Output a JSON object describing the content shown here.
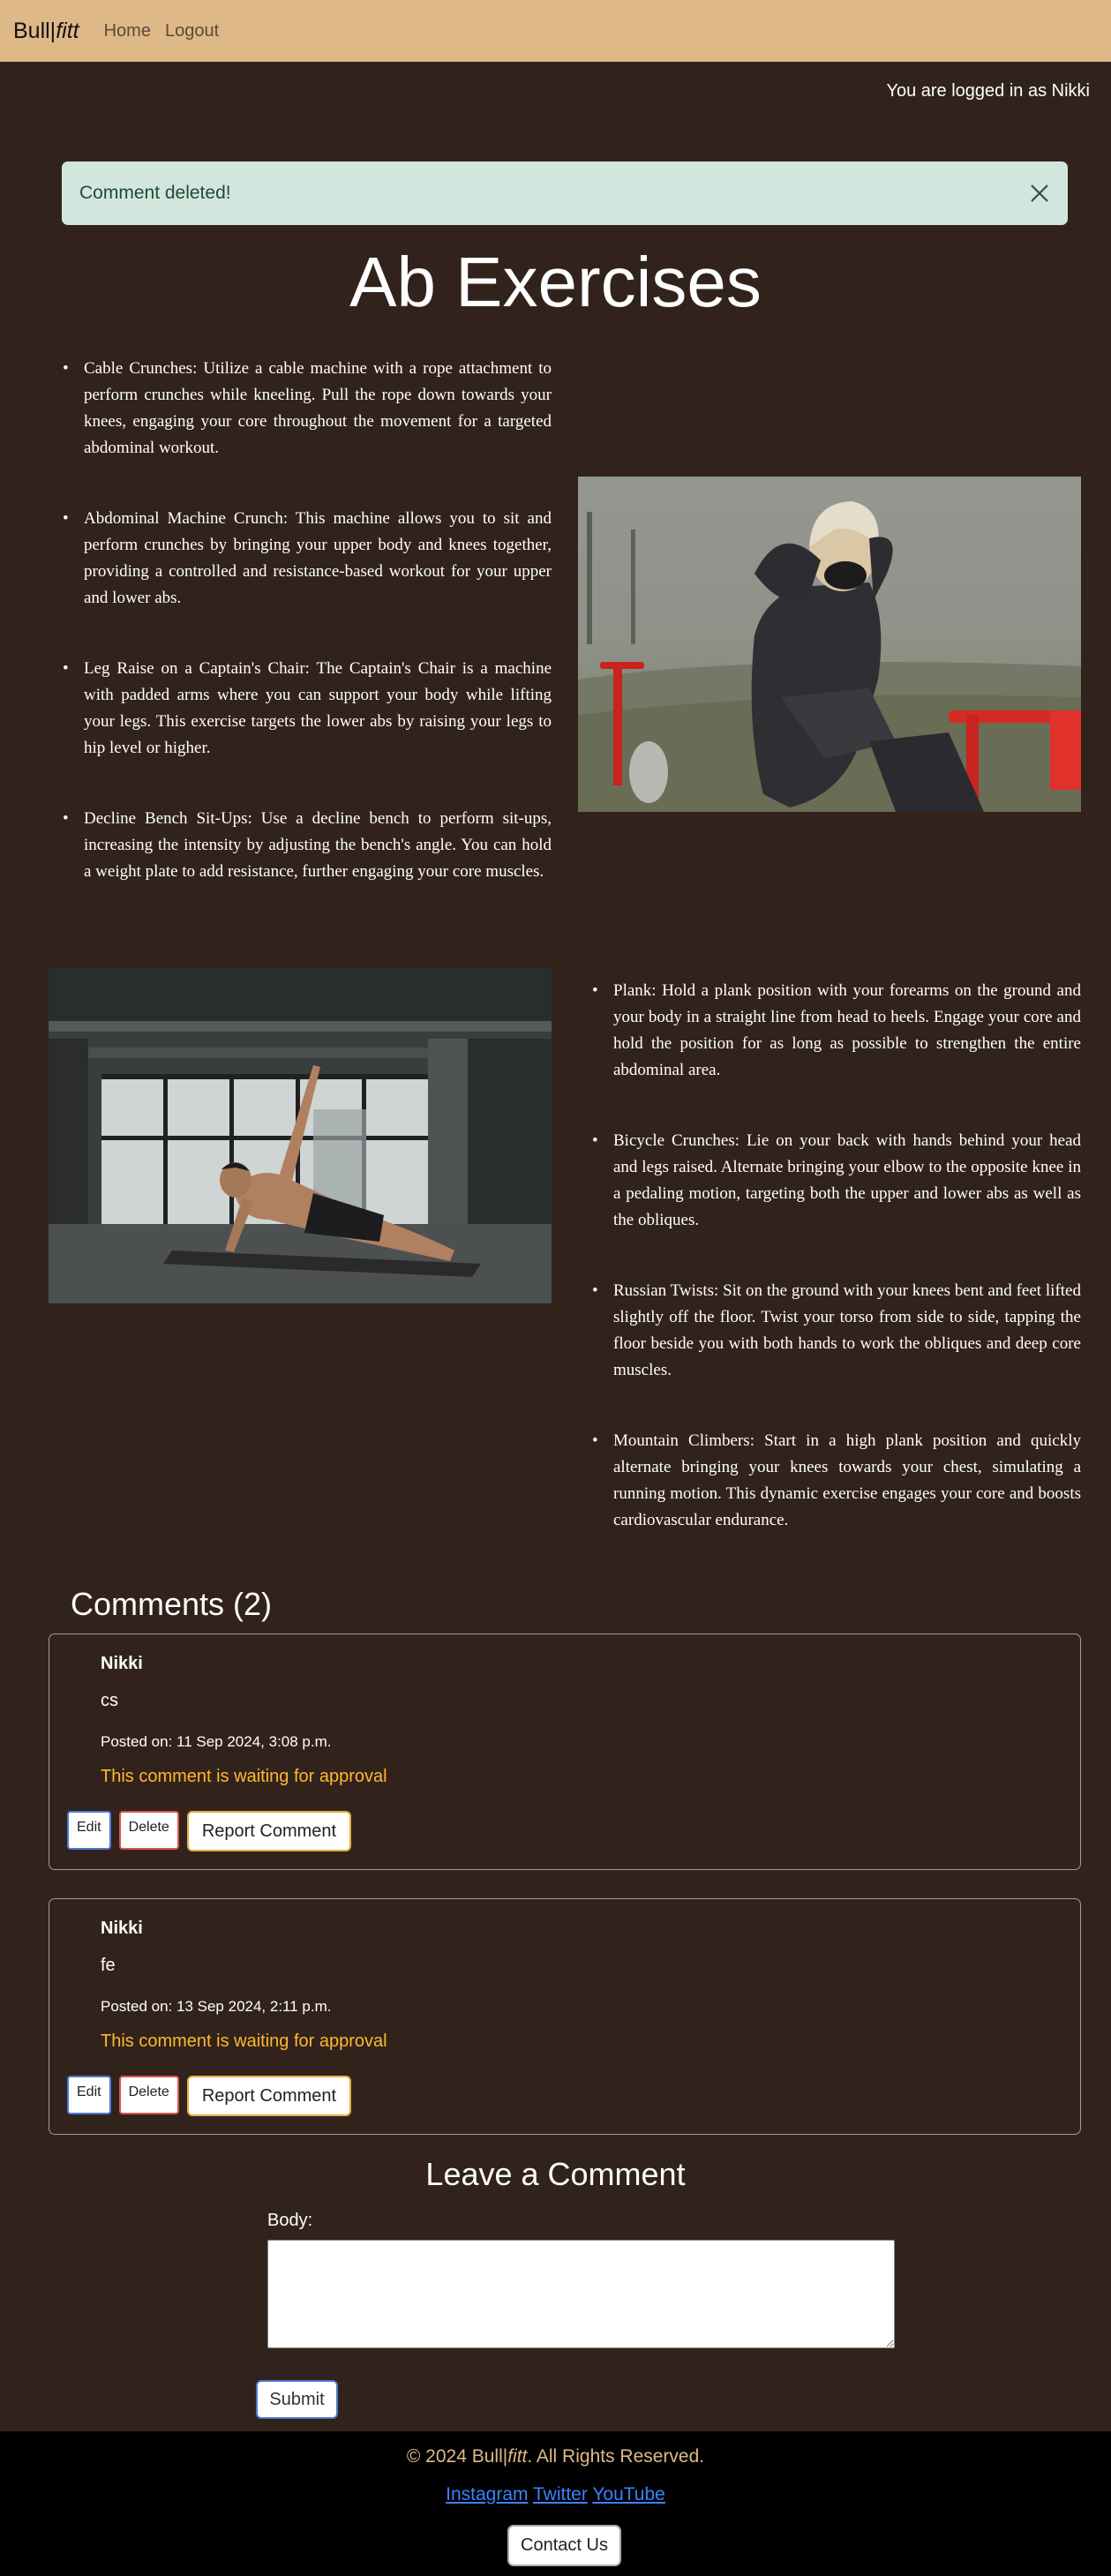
{
  "nav": {
    "brand_part1": "Bull|",
    "brand_part2": "fitt",
    "links": [
      "Home",
      "Logout"
    ]
  },
  "user": {
    "logged_in_text": "You are logged in as Nikki"
  },
  "alert": {
    "message": "Comment deleted!",
    "close_icon": "close-icon"
  },
  "page": {
    "title": "Ab Exercises"
  },
  "exercises_left": [
    "Cable Crunches: Utilize a cable machine with a rope attachment to perform crunches while kneeling. Pull the rope down towards your knees, engaging your core throughout the movement for a targeted abdominal workout.",
    "Abdominal Machine Crunch: This machine allows you to sit and perform crunches by bringing your upper body and knees together, providing a controlled and resistance-based workout for your upper and lower abs.",
    "Leg Raise on a Captain's Chair: The Captain's Chair is a machine with padded arms where you can support your body while lifting your legs. This exercise targets the lower abs by raising your legs to hip level or higher.",
    "Decline Bench Sit-Ups: Use a decline bench to perform sit-ups, increasing the intensity by adjusting the bench's angle. You can hold a weight plate to add resistance, further engaging your core muscles."
  ],
  "exercises_right": [
    "Plank: Hold a plank position with your forearms on the ground and your body in a straight line from head to heels. Engage your core and hold the position for as long as possible to strengthen the entire abdominal area.",
    "Bicycle Crunches: Lie on your back with hands behind your head and legs raised. Alternate bringing your elbow to the opposite knee in a pedaling motion, targeting both the upper and lower abs as well as the obliques.",
    "Russian Twists: Sit on the ground with your knees bent and feet lifted slightly off the floor. Twist your torso from side to side, tapping the floor beside you with both hands to work the obliques and deep core muscles.",
    "Mountain Climbers: Start in a high plank position and quickly alternate bringing your knees towards your chest, simulating a running motion. This dynamic exercise engages your core and boosts cardiovascular endurance."
  ],
  "comments": {
    "heading": "Comments (2)",
    "items": [
      {
        "author": "Nikki",
        "body": "cs",
        "posted": "Posted on: 11 Sep 2024, 3:08 p.m.",
        "status": "This comment is waiting for approval",
        "edit_label": "Edit",
        "delete_label": "Delete",
        "report_label": "Report Comment"
      },
      {
        "author": "Nikki",
        "body": "fe",
        "posted": "Posted on: 13 Sep 2024, 2:11 p.m.",
        "status": "This comment is waiting for approval",
        "edit_label": "Edit",
        "delete_label": "Delete",
        "report_label": "Report Comment"
      }
    ]
  },
  "leave_comment": {
    "heading": "Leave a Comment",
    "body_label": "Body:",
    "body_value": "",
    "submit_label": "Submit"
  },
  "footer": {
    "copyright_prefix": "© 2024 Bull|",
    "copyright_brand": "fitt",
    "copyright_suffix": ". All Rights Reserved.",
    "social_links": [
      "Instagram",
      "Twitter",
      "YouTube"
    ],
    "contact_label": "Contact Us"
  },
  "colors": {
    "navbar": "#dfb887",
    "background": "#31231b",
    "alert_bg": "#d1e7dd",
    "pending_status": "#ffb82e",
    "link": "#3b82ff"
  }
}
